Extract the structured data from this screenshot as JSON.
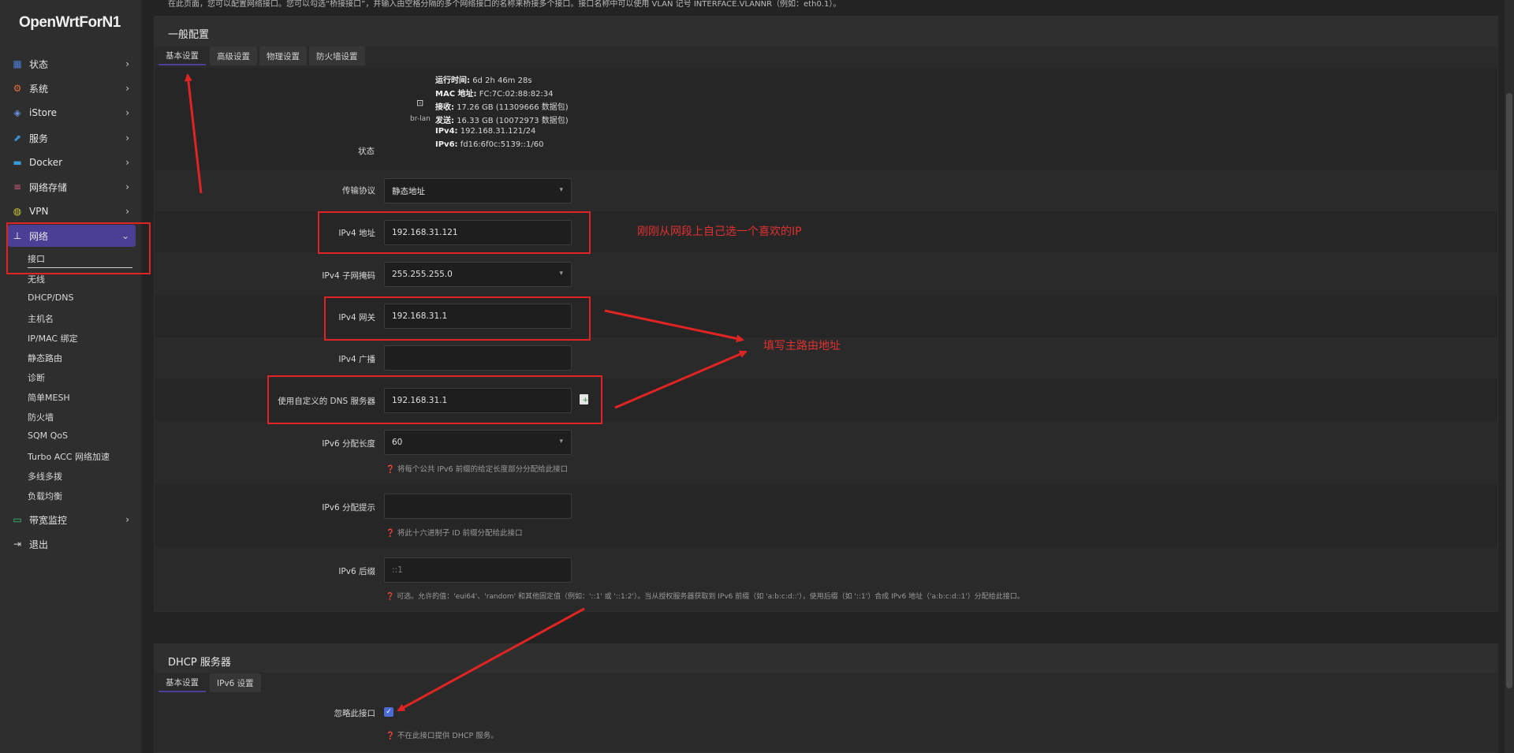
{
  "app": {
    "logo": "OpenWrtForN1"
  },
  "top_note": "在此页面，您可以配置网络接口。您可以勾选“桥接接口”，并输入由空格分隔的多个网络接口的名称来桥接多个接口。接口名称中可以使用 VLAN 记号 INTERFACE.VLANNR（例如：eth0.1）。",
  "sidebar": {
    "items": [
      {
        "label": "状态",
        "icon": "dashboard-icon",
        "color": "#4a7fd6"
      },
      {
        "label": "系统",
        "icon": "gear-icon",
        "color": "#e86a3a"
      },
      {
        "label": "iStore",
        "icon": "cube-icon",
        "color": "#6a8fe0"
      },
      {
        "label": "服务",
        "icon": "service-icon",
        "color": "#3a8fd6"
      },
      {
        "label": "Docker",
        "icon": "docker-icon",
        "color": "#3a9ad9"
      },
      {
        "label": "网络存储",
        "icon": "storage-icon",
        "color": "#d65a7a"
      },
      {
        "label": "VPN",
        "icon": "vpn-icon",
        "color": "#c8c83a"
      },
      {
        "label": "网络",
        "icon": "network-icon",
        "color": "#ffffff"
      }
    ],
    "network_sub": [
      "接口",
      "无线",
      "DHCP/DNS",
      "主机名",
      "IP/MAC 绑定",
      "静态路由",
      "诊断",
      "简单MESH",
      "防火墙",
      "SQM QoS",
      "Turbo ACC 网络加速",
      "多线多拨",
      "负载均衡"
    ],
    "bottom_items": [
      {
        "label": "带宽监控",
        "icon": "monitor-icon",
        "color": "#3ac87a"
      },
      {
        "label": "退出",
        "icon": "logout-icon",
        "color": "#cfcfcf"
      }
    ]
  },
  "general": {
    "title": "一般配置",
    "tabs": [
      "基本设置",
      "高级设置",
      "物理设置",
      "防火墙设置"
    ],
    "status_label": "状态",
    "device": "br-lan",
    "status": [
      {
        "k": "运行时间:",
        "v": "6d 2h 46m 28s"
      },
      {
        "k": "MAC 地址:",
        "v": "FC:7C:02:88:82:34"
      },
      {
        "k": "接收:",
        "v": "17.26 GB (11309666 数据包)"
      },
      {
        "k": "发送:",
        "v": "16.33 GB (10072973 数据包)"
      },
      {
        "k": "IPv4:",
        "v": "192.168.31.121/24"
      },
      {
        "k": "IPv6:",
        "v": "fd16:6f0c:5139::1/60"
      }
    ],
    "fields": {
      "protocol": {
        "label": "传输协议",
        "value": "静态地址"
      },
      "ipv4_addr": {
        "label": "IPv4 地址",
        "value": "192.168.31.121"
      },
      "ipv4_mask": {
        "label": "IPv4 子网掩码",
        "value": "255.255.255.0"
      },
      "ipv4_gw": {
        "label": "IPv4 网关",
        "value": "192.168.31.1"
      },
      "ipv4_bcast": {
        "label": "IPv4 广播",
        "value": ""
      },
      "dns": {
        "label": "使用自定义的 DNS 服务器",
        "value": "192.168.31.1"
      },
      "ipv6_len": {
        "label": "IPv6 分配长度",
        "value": "60",
        "hint": "将每个公共 IPv6 前缀的给定长度部分分配给此接口"
      },
      "ipv6_hint": {
        "label": "IPv6 分配提示",
        "value": "",
        "hint": "将此十六进制子 ID 前缀分配给此接口"
      },
      "ipv6_suffix": {
        "label": "IPv6 后缀",
        "placeholder": "::1",
        "hint": "可选。允许的值：'eui64'、'random' 和其他固定值（例如：'::1' 或 '::1:2'）。当从授权服务器获取到 IPv6 前缀（如 'a:b:c:d::'），使用后缀（如 '::1'）合成 IPv6 地址（'a:b:c:d::1'）分配给此接口。"
      }
    }
  },
  "dhcp": {
    "title": "DHCP 服务器",
    "tabs": [
      "基本设置",
      "IPv6 设置"
    ],
    "ignore_label": "忽略此接口",
    "ignore_hint": "不在此接口提供 DHCP 服务。",
    "ignore_checked": "✓"
  },
  "annotations": {
    "ip_note": "刚刚从网段上自己选一个喜欢的IP",
    "gw_note": "填写主路由地址"
  }
}
